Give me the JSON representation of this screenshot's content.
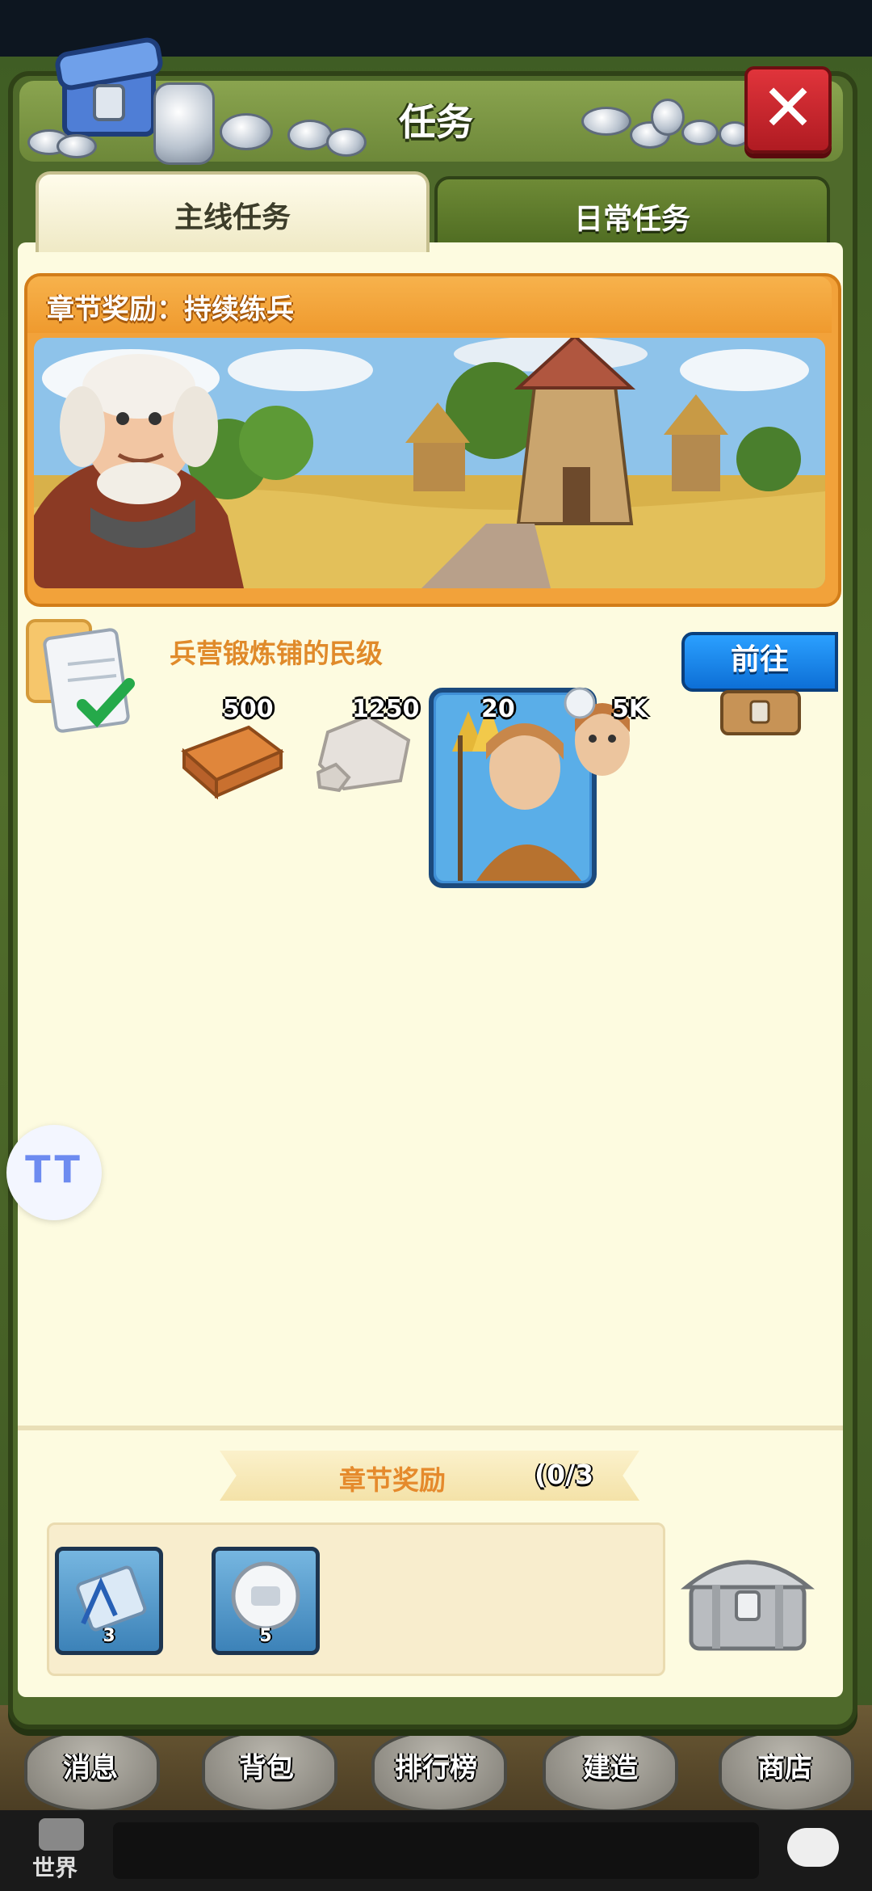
{
  "dialog": {
    "title": "任务",
    "close_icon": "close-x-icon"
  },
  "tabs": [
    {
      "label": "主线任务",
      "active": true
    },
    {
      "label": "日常任务",
      "active": false
    }
  ],
  "chapter": {
    "title": "章节奖励：持续练兵"
  },
  "task": {
    "name": "兵营锻炼铺的民级",
    "goto_label": "前往",
    "rewards": [
      {
        "icon": "wood-planks-icon",
        "count": "500"
      },
      {
        "icon": "stone-icon",
        "count": "1250"
      },
      {
        "icon": "farmer-card-icon",
        "count": "20"
      },
      {
        "icon": "villager-head-icon",
        "count": "5K"
      }
    ]
  },
  "chapter_rewards": {
    "title": "章节奖励",
    "progress": "(0/3",
    "items": [
      {
        "icon": "blueprint-scroll-icon",
        "count": "3"
      },
      {
        "icon": "silver-coin-icon",
        "count": "5"
      }
    ]
  },
  "assist": {
    "label": "TT"
  },
  "bottom_nav": [
    {
      "label": "消息"
    },
    {
      "label": "背包"
    },
    {
      "label": "排行榜"
    },
    {
      "label": "建造"
    },
    {
      "label": "商店"
    }
  ],
  "chat": {
    "world_label": "世界"
  },
  "colors": {
    "panel_bg": "#fdfbe0",
    "frame_green": "#4f6a2b",
    "banner_orange": "#f2a23a",
    "goto_blue": "#1a88ea",
    "close_red": "#d0262d"
  }
}
